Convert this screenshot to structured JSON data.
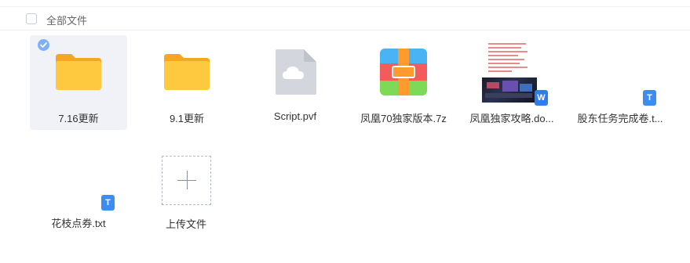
{
  "header": {
    "select_all_label": "全部文件"
  },
  "files": [
    {
      "name": "7.16更新",
      "type": "folder",
      "selected": true
    },
    {
      "name": "9.1更新",
      "type": "folder",
      "selected": false
    },
    {
      "name": "Script.pvf",
      "type": "cloud-file",
      "selected": false
    },
    {
      "name": "凤凰70独家版本.7z",
      "type": "archive",
      "selected": false
    },
    {
      "name": "凤凰独家攻略.do...",
      "type": "word-doc",
      "badge": "W",
      "selected": false
    },
    {
      "name": "股东任务完成卷.t...",
      "type": "text",
      "badge": "T",
      "selected": false
    },
    {
      "name": "花枝点券.txt",
      "type": "text",
      "badge": "T",
      "selected": false
    }
  ],
  "upload": {
    "label": "上传文件"
  },
  "colors": {
    "folder": "#ffc93f",
    "selected_bg": "#f0f2f7",
    "badge_blue": "#3d8cf2",
    "check": "#7fb0f5"
  }
}
